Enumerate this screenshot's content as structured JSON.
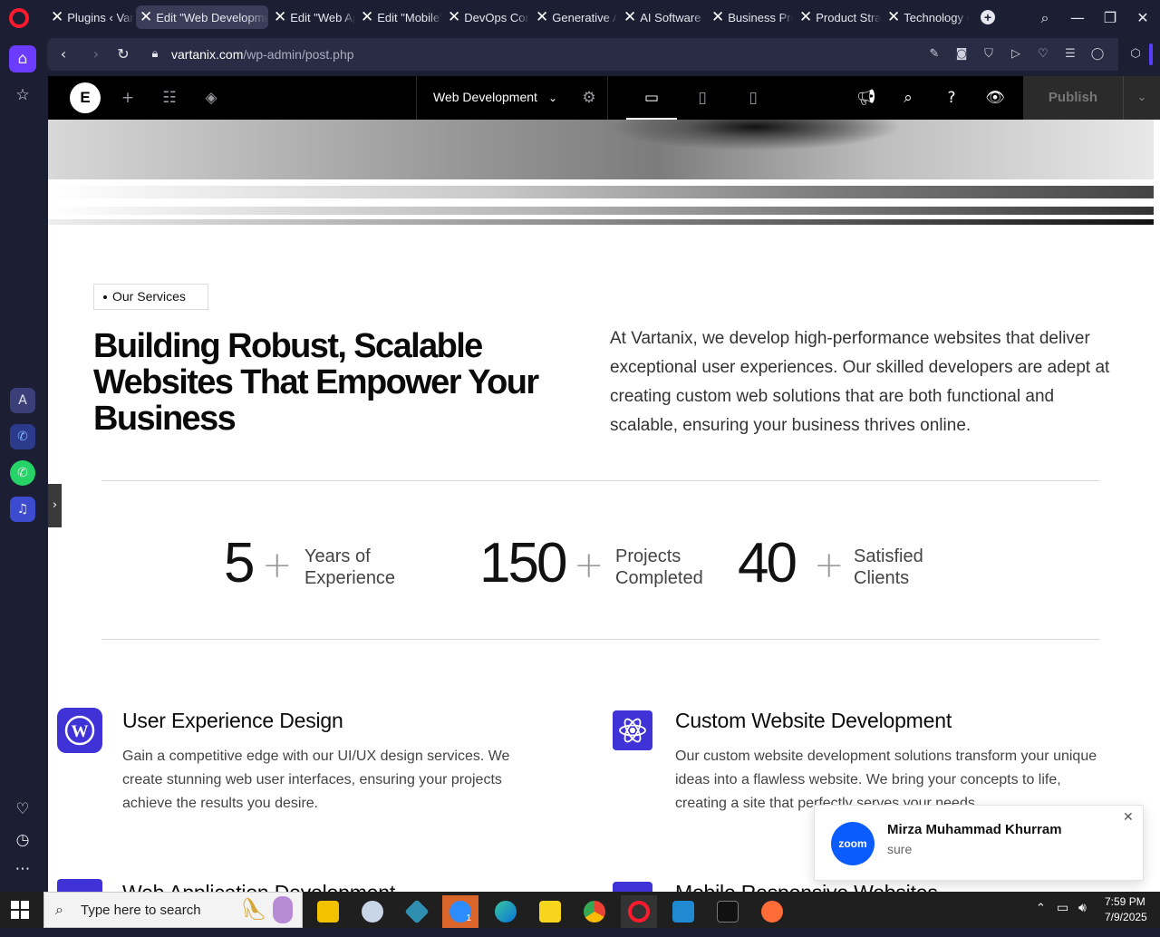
{
  "browser": {
    "tabs": [
      {
        "title": "Plugins ‹ Vartanix"
      },
      {
        "title": "Edit \"Web Development\""
      },
      {
        "title": "Edit \"Web Applications\""
      },
      {
        "title": "Edit \"Mobile\""
      },
      {
        "title": "DevOps Consulting"
      },
      {
        "title": "Generative AI"
      },
      {
        "title": "AI Software Development"
      },
      {
        "title": "Business Process"
      },
      {
        "title": "Product Strategy"
      },
      {
        "title": "Technology Consulting"
      }
    ],
    "url_domain": "vartanix.com",
    "url_path": "/wp-admin/post.php",
    "new_tab_glyph": "+"
  },
  "elementor": {
    "logo_text": "E",
    "page_name": "Web Development",
    "publish_label": "Publish"
  },
  "page": {
    "tag": "Our Services",
    "heading": "Building Robust, Scalable Websites That Empower Your Business",
    "intro": "At Vartanix, we develop high-performance websites that deliver exceptional user experiences. Our skilled developers are adept at creating custom web solutions that are both functional and scalable, ensuring your business thrives online.",
    "stats": [
      {
        "number": "5",
        "plus": "+",
        "label_line1": "Years of",
        "label_line2": "Experience"
      },
      {
        "number": "150",
        "plus": "+",
        "label_line1": "Projects",
        "label_line2": "Completed"
      },
      {
        "number": "40",
        "plus": "+",
        "label_line1": "Satisfied",
        "label_line2": "Clients"
      }
    ],
    "services": [
      {
        "title": "User Experience Design",
        "desc": "Gain a competitive edge with our UI/UX design services. We create stunning web user interfaces, ensuring your projects achieve the results you desire.",
        "icon": "wordpress-icon"
      },
      {
        "title": "Custom Website Development",
        "desc": "Our custom website development solutions transform your unique ideas into a flawless website. We bring your concepts to life, creating a site that perfectly serves your needs.",
        "icon": "atom-icon"
      },
      {
        "title": "Web Application Development",
        "icon": "code-window-icon"
      },
      {
        "title": "Mobile Responsive Websites",
        "icon": "responsive-icon"
      }
    ],
    "accent_color": "#3f32d6"
  },
  "notification": {
    "app_logo_text": "zoom",
    "sender": "Mirza Muhammad Khurram",
    "message": "sure"
  },
  "taskbar": {
    "search_placeholder": "Type here to search",
    "time": "7:59 PM",
    "date": "7/9/2025",
    "zoom_badge": "1"
  }
}
